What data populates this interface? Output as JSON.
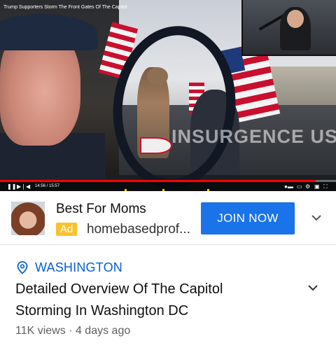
{
  "video": {
    "title_overlay": "Trump Supporters Storm The Front Gates Of The Capitol",
    "watermark": "INSURGENCE USA",
    "time": "14:56 / 15:57",
    "progress": 0.94,
    "colors": {
      "progress": "#ff0000",
      "marker": "#f4d200"
    }
  },
  "ad": {
    "advertiser": "Best For Moms",
    "badge": "Ad",
    "domain": "homebasedprof...",
    "cta": "JOIN NOW",
    "colors": {
      "cta": "#1a73e8",
      "badge": "#f9c22e"
    }
  },
  "info": {
    "location": "WASHINGTON",
    "title": "Detailed Overview Of The Capitol Storming In Washington DC",
    "meta": "11K views · 4 days ago",
    "colors": {
      "location": "#065fd4"
    }
  }
}
